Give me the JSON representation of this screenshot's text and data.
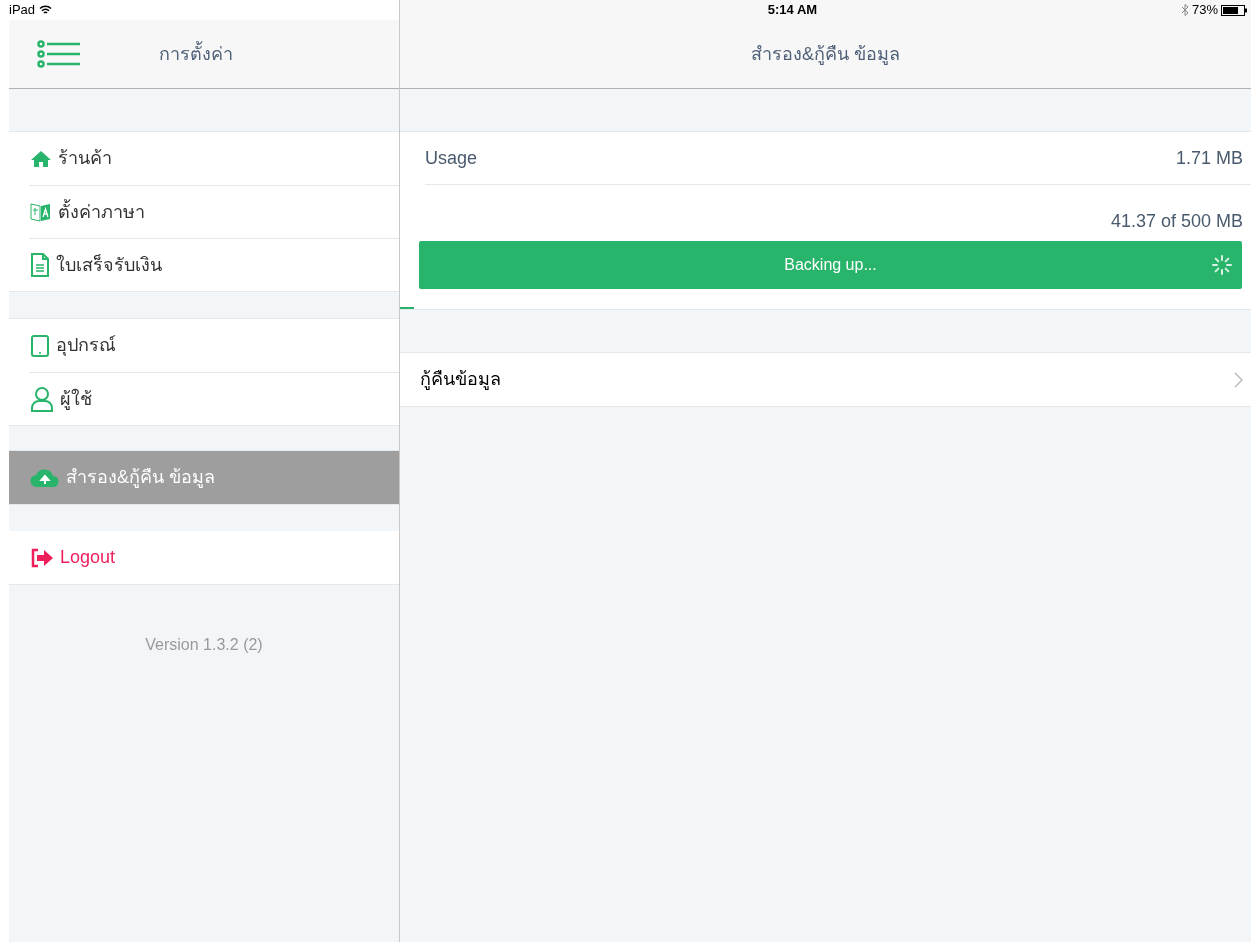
{
  "status_bar": {
    "device": "iPad",
    "time": "5:14 AM",
    "battery": "73%"
  },
  "sidebar": {
    "title": "การตั้งค่า",
    "groups": [
      {
        "items": [
          {
            "kind": "home",
            "label": "ร้านค้า",
            "selected": false
          },
          {
            "kind": "language",
            "label": "ตั้งค่าภาษา",
            "selected": false
          },
          {
            "kind": "receipt",
            "label": "ใบเสร็จรับเงิน",
            "selected": false
          }
        ]
      },
      {
        "items": [
          {
            "kind": "tablet",
            "label": "อุปกรณ์",
            "selected": false
          },
          {
            "kind": "user",
            "label": "ผู้ใช้",
            "selected": false
          }
        ]
      },
      {
        "items": [
          {
            "kind": "cloud",
            "label": "สำรอง&กู้คืน ข้อมูล",
            "selected": true
          }
        ]
      }
    ],
    "logout": "Logout",
    "version": "Version 1.3.2 (2)"
  },
  "main": {
    "title": "สำรอง&กู้คืน ข้อมูล",
    "usage": {
      "label": "Usage",
      "value": "1.71 MB"
    },
    "storage": "41.37 of 500 MB",
    "backup_button": "Backing up...",
    "progress": {
      "level": 0.016
    },
    "restore": "กู้คืนข้อมูล"
  }
}
